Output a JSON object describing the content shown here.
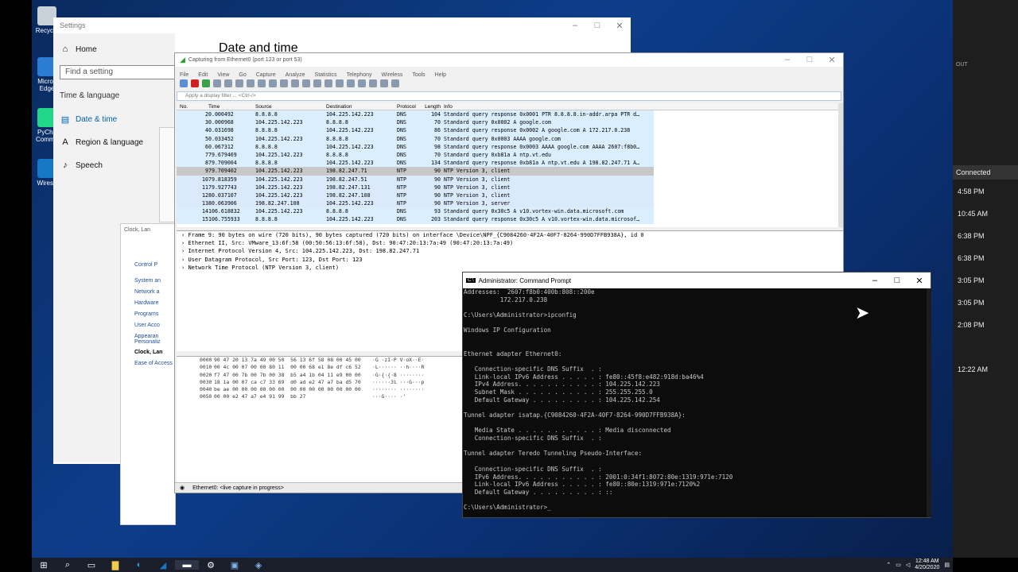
{
  "desktop": {
    "icons": [
      {
        "label": "Recycle",
        "glyph": "recycle-bin-icon",
        "color": "#c8d0d8"
      },
      {
        "label": "Micros Edge",
        "glyph": "edge-icon",
        "color": "#2b7cd3"
      },
      {
        "label": "PyCha Commu",
        "glyph": "pycharm-icon",
        "color": "#21d789"
      },
      {
        "label": "Wiresh",
        "glyph": "wireshark-icon",
        "color": "#1679c7"
      }
    ]
  },
  "right_pane": {
    "connected": "Connected",
    "times": [
      "4:58 PM",
      "10:45 AM",
      "6:38 PM",
      "6:38 PM",
      "3:05 PM",
      "3:05 PM",
      "2:08 PM",
      "12:22 AM"
    ],
    "out": "OUT"
  },
  "settings": {
    "title": "Settings",
    "home": "Home",
    "search_placeholder": "Find a setting",
    "section": "Time & language",
    "items": [
      "Date & time",
      "Region & language",
      "Speech"
    ],
    "page_title": "Date and time"
  },
  "control_panel": {
    "title": "Clock, Lan",
    "links": [
      "Control P",
      "System an",
      "Network a",
      "Hardware",
      "Programs",
      "User Acco",
      "Appearan Personaliz",
      "Clock, Lan",
      "Ease of Access"
    ]
  },
  "wireshark": {
    "title": "Capturing from Ethernet0 (port 123 or port 53)",
    "menu": [
      "File",
      "Edit",
      "View",
      "Go",
      "Capture",
      "Analyze",
      "Statistics",
      "Telephony",
      "Wireless",
      "Tools",
      "Help"
    ],
    "filter_placeholder": "Apply a display filter ... <Ctrl-/>",
    "columns": [
      "No.",
      "Time",
      "Source",
      "Destination",
      "Protocol",
      "Length",
      "Info"
    ],
    "packets": [
      [
        "2",
        "0.000492",
        "8.8.8.8",
        "104.225.142.223",
        "DNS",
        "104",
        "Standard query response 0x0001 PTR 8.8.8.8.in-addr.arpa PTR d…"
      ],
      [
        "3",
        "0.000968",
        "104.225.142.223",
        "8.8.8.8",
        "DNS",
        "70",
        "Standard query 0x0002 A google.com"
      ],
      [
        "4",
        "0.031698",
        "8.8.8.8",
        "104.225.142.223",
        "DNS",
        "86",
        "Standard query response 0x0002 A google.com A 172.217.0.238"
      ],
      [
        "5",
        "0.033452",
        "104.225.142.223",
        "8.8.8.8",
        "DNS",
        "70",
        "Standard query 0x0003 AAAA google.com"
      ],
      [
        "6",
        "0.067312",
        "8.8.8.8",
        "104.225.142.223",
        "DNS",
        "98",
        "Standard query response 0x0003 AAAA google.com AAAA 2607:f8b0…"
      ],
      [
        "7",
        "79.679469",
        "104.225.142.223",
        "8.8.8.8",
        "DNS",
        "70",
        "Standard query 0xb81a A ntp.vt.edu"
      ],
      [
        "8",
        "79.709004",
        "8.8.8.8",
        "104.225.142.223",
        "DNS",
        "134",
        "Standard query response 0xb81a A ntp.vt.edu A 198.82.247.71 A…"
      ],
      [
        "9",
        "79.709402",
        "104.225.142.223",
        "198.82.247.71",
        "NTP",
        "90",
        "NTP Version 3, client"
      ],
      [
        "10",
        "79.818359",
        "104.225.142.223",
        "198.82.247.51",
        "NTP",
        "90",
        "NTP Version 3, client"
      ],
      [
        "11",
        "79.927743",
        "104.225.142.223",
        "198.82.247.131",
        "NTP",
        "90",
        "NTP Version 3, client"
      ],
      [
        "12",
        "80.037107",
        "104.225.142.223",
        "198.82.247.108",
        "NTP",
        "90",
        "NTP Version 3, client"
      ],
      [
        "13",
        "80.063906",
        "198.82.247.108",
        "104.225.142.223",
        "NTP",
        "90",
        "NTP Version 3, server"
      ],
      [
        "14",
        "106.618832",
        "104.225.142.223",
        "8.8.8.8",
        "DNS",
        "93",
        "Standard query 0x30c5 A v10.vortex-win.data.microsoft.com"
      ],
      [
        "15",
        "106.755933",
        "8.8.8.8",
        "104.225.142.223",
        "DNS",
        "203",
        "Standard query response 0x30c5 A v10.vortex-win.data.microsof…"
      ]
    ],
    "details": [
      "Frame 9: 90 bytes on wire (720 bits), 90 bytes captured (720 bits) on interface \\Device\\NPF_{C9084260-4F2A-40F7-8264-990D7FFB938A}, id 0",
      "Ethernet II, Src: VMware_13:6f:58 (00:50:56:13:6f:58), Dst: 90:47:20:13:7a:49 (90:47:20:13:7a:49)",
      "Internet Protocol Version 4, Src: 104.225.142.223, Dst: 198.82.247.71",
      "User Datagram Protocol, Src Port: 123, Dst Port: 123",
      "Network Time Protocol (NTP Version 3, client)"
    ],
    "hex": [
      [
        "0000",
        "90 47 20 13 7a 49 00 50  56 13 6f 58 08 00 45 00",
        "·G ·zI·P V·oX··E·"
      ],
      [
        "0010",
        "00 4c 00 07 00 00 80 11  00 00 68 e1 8e df c6 52",
        "·L······ ··h····R"
      ],
      [
        "0020",
        "f7 47 00 7b 00 7b 00 38  b5 a4 1b 04 11 e9 00 00",
        "·G·{·{·8 ········"
      ],
      [
        "0030",
        "18 1a 00 07 ca c7 33 69  d0 ad e2 47 a7 ba d5 70",
        "······3i ···G···p"
      ],
      [
        "0040",
        "be ae 00 00 00 00 00 00  00 00 00 00 00 00 00 00",
        "········ ········"
      ],
      [
        "0050",
        "00 00 e2 47 a7 e4 91 99  bb 27",
        "···G···· ·'"
      ]
    ],
    "status": "Ethernet0: <live capture in progress>"
  },
  "cmd": {
    "title": "Administrator: Command Prompt",
    "lines": [
      "Addresses:  2607:f8b0:400b:808::200e",
      "          172.217.0.238",
      "",
      "C:\\Users\\Administrator>ipconfig",
      "",
      "Windows IP Configuration",
      "",
      "",
      "Ethernet adapter Ethernet0:",
      "",
      "   Connection-specific DNS Suffix  . :",
      "   Link-local IPv6 Address . . . . . : fe80::45f8:e482:918d:ba46%4",
      "   IPv4 Address. . . . . . . . . . . : 104.225.142.223",
      "   Subnet Mask . . . . . . . . . . . : 255.255.255.0",
      "   Default Gateway . . . . . . . . . : 104.225.142.254",
      "",
      "Tunnel adapter isatap.{C9084260-4F2A-40F7-8264-990D7FFB938A}:",
      "",
      "   Media State . . . . . . . . . . . : Media disconnected",
      "   Connection-specific DNS Suffix  . :",
      "",
      "Tunnel adapter Teredo Tunneling Pseudo-Interface:",
      "",
      "   Connection-specific DNS Suffix  . :",
      "   IPv6 Address. . . . . . . . . . . : 2001:0:34f1:8072:80e:1319:971e:7120",
      "   Link-local IPv6 Address . . . . . : fe80::80e:1319:971e:7120%2",
      "   Default Gateway . . . . . . . . . : ::",
      "",
      "C:\\Users\\Administrator>_"
    ]
  },
  "taskbar": {
    "time": "12:48 AM",
    "date": "4/20/2020"
  }
}
